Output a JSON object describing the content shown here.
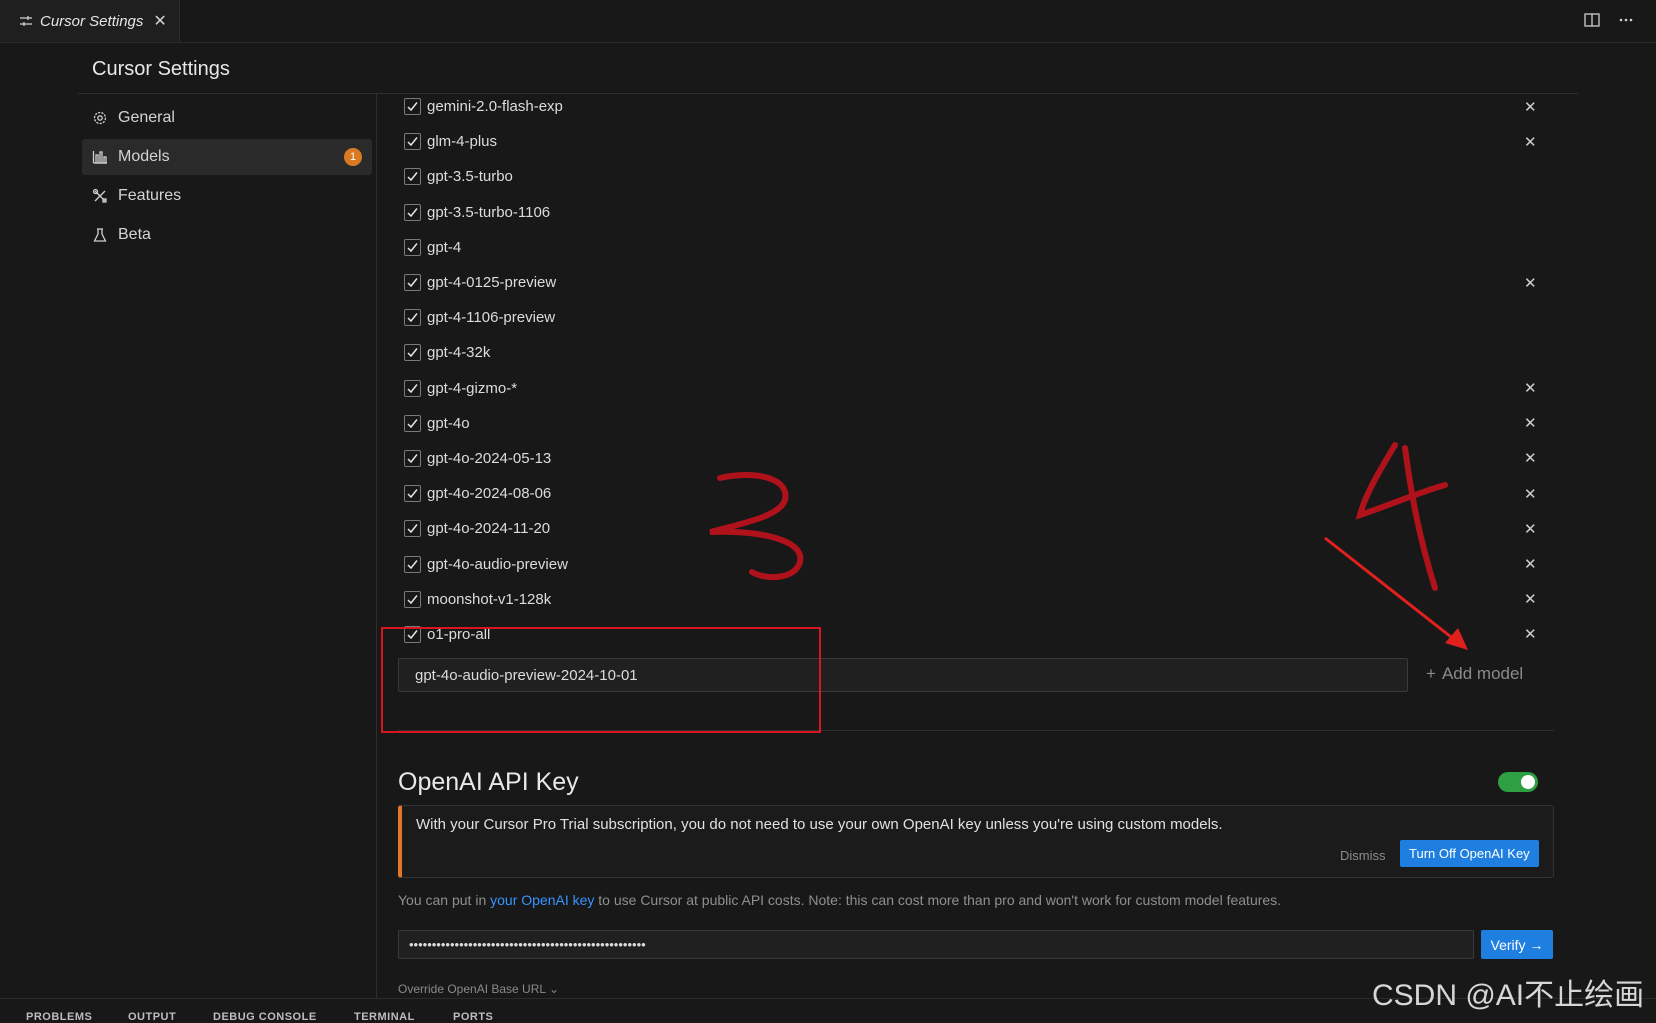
{
  "tab": {
    "title": "Cursor Settings",
    "close": "✕"
  },
  "page_title": "Cursor Settings",
  "nav": [
    {
      "label": "General",
      "icon": "gear-icon"
    },
    {
      "label": "Models",
      "icon": "bar-chart-icon",
      "badge": "1",
      "active": true
    },
    {
      "label": "Features",
      "icon": "tools-icon"
    },
    {
      "label": "Beta",
      "icon": "flask-icon"
    }
  ],
  "models": [
    {
      "name": "gemini-2.0-flash-exp",
      "checked": true,
      "removable": true
    },
    {
      "name": "glm-4-plus",
      "checked": true,
      "removable": true
    },
    {
      "name": "gpt-3.5-turbo",
      "checked": true,
      "removable": false
    },
    {
      "name": "gpt-3.5-turbo-1106",
      "checked": true,
      "removable": false
    },
    {
      "name": "gpt-4",
      "checked": true,
      "removable": false
    },
    {
      "name": "gpt-4-0125-preview",
      "checked": true,
      "removable": true
    },
    {
      "name": "gpt-4-1106-preview",
      "checked": true,
      "removable": false
    },
    {
      "name": "gpt-4-32k",
      "checked": true,
      "removable": false
    },
    {
      "name": "gpt-4-gizmo-*",
      "checked": true,
      "removable": true
    },
    {
      "name": "gpt-4o",
      "checked": true,
      "removable": true
    },
    {
      "name": "gpt-4o-2024-05-13",
      "checked": true,
      "removable": true
    },
    {
      "name": "gpt-4o-2024-08-06",
      "checked": true,
      "removable": true
    },
    {
      "name": "gpt-4o-2024-11-20",
      "checked": true,
      "removable": true
    },
    {
      "name": "gpt-4o-audio-preview",
      "checked": true,
      "removable": true
    },
    {
      "name": "moonshot-v1-128k",
      "checked": true,
      "removable": true
    },
    {
      "name": "o1-pro-all",
      "checked": true,
      "removable": true
    }
  ],
  "new_model_value": "gpt-4o-audio-preview-2024-10-01",
  "add_model_label": "Add model",
  "openai": {
    "title": "OpenAI API Key",
    "toggle_on": true,
    "notice": "With your Cursor Pro Trial subscription, you do not need to use your own OpenAI key unless you're using custom models.",
    "dismiss": "Dismiss",
    "turn_off": "Turn Off OpenAI Key",
    "help_prefix": "You can put in ",
    "help_link": "your OpenAI key",
    "help_suffix": " to use Cursor at public API costs. Note: this can cost more than pro and won't work for custom model features.",
    "key_value": "••••••••••••••••••••••••••••••••••••••••••••••••••••",
    "verify": "Verify →",
    "override": "Override OpenAI Base URL ⌄"
  },
  "panel_tabs": [
    "PROBLEMS",
    "OUTPUT",
    "DEBUG CONSOLE",
    "TERMINAL",
    "PORTS"
  ],
  "annotations": {
    "label_3": "3",
    "label_4": "4",
    "color": "#b0121b",
    "arrow_color": "#e0201c"
  },
  "watermark": "CSDN @AI不止绘画",
  "colors": {
    "accent_blue": "#1f7fe0",
    "badge_orange": "#d97a22",
    "toggle_green": "#2ea043",
    "notice_orange": "#e2772b"
  }
}
